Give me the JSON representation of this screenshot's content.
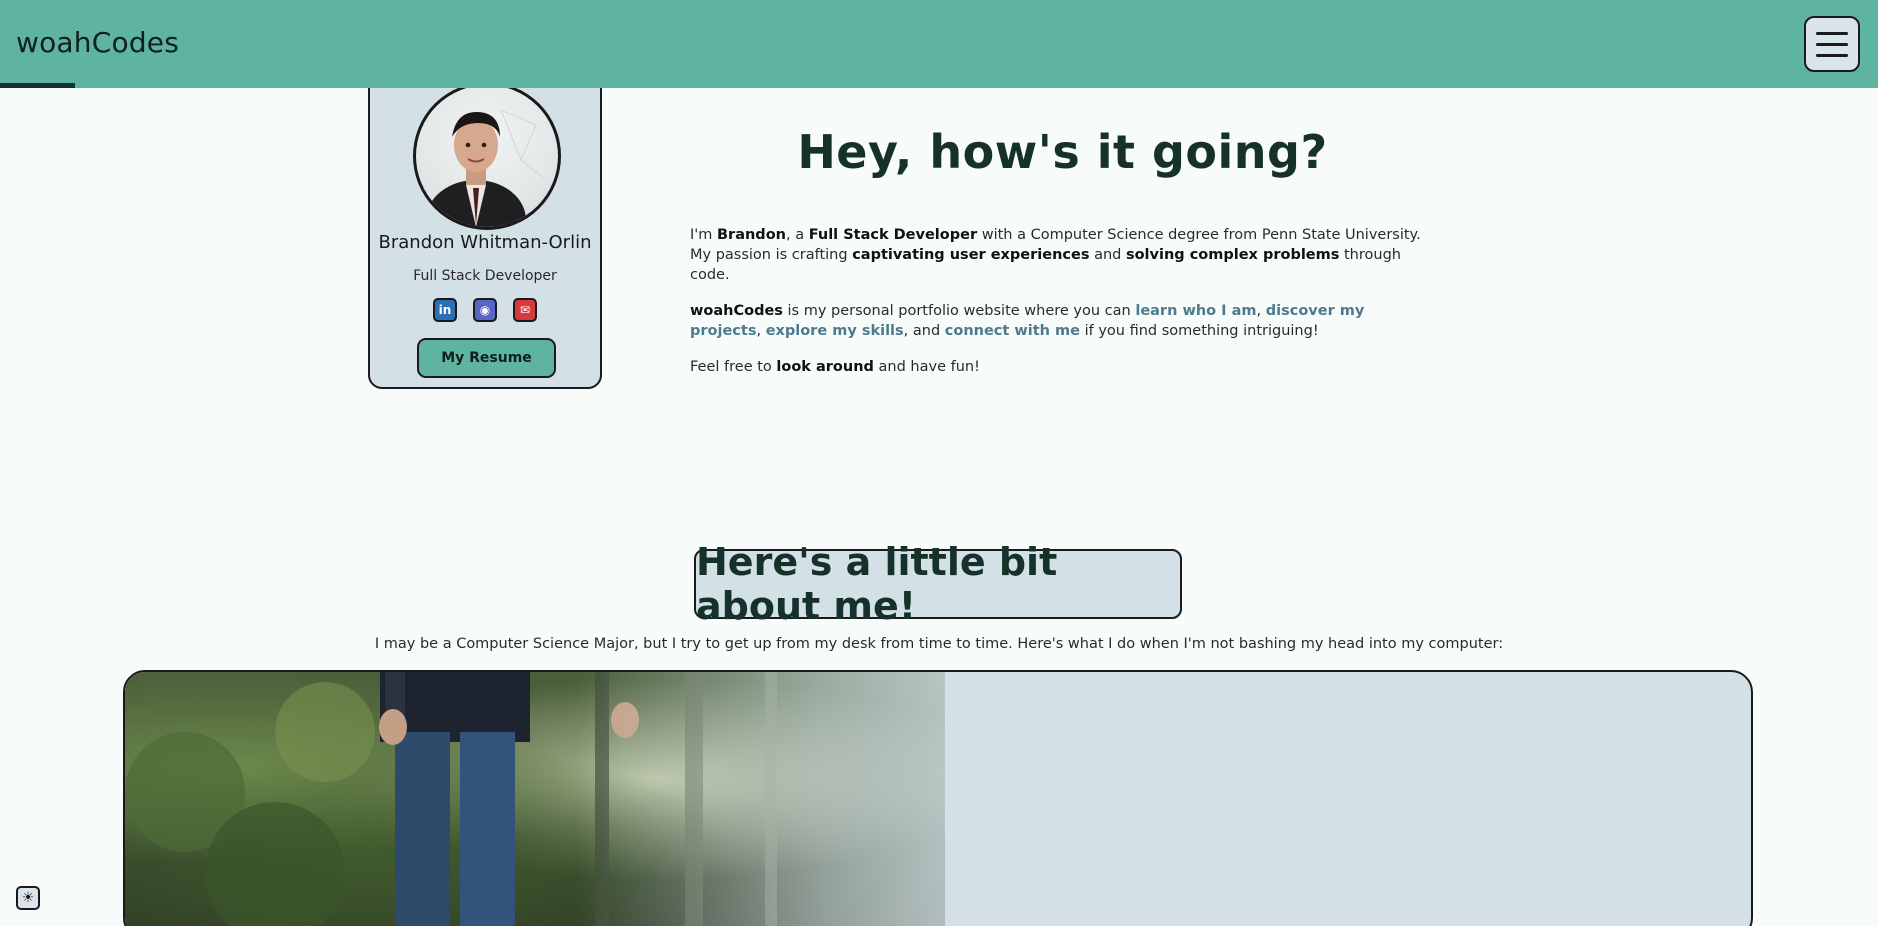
{
  "header": {
    "brand": "woahCodes",
    "menu_icon": "hamburger-menu-icon"
  },
  "profile": {
    "name": "Brandon Whitman-Orlin",
    "role": "Full Stack Developer",
    "avatar_icon": "profile-photo",
    "socials": [
      {
        "name": "linkedin",
        "glyph": "in",
        "color": "#2d6fb3",
        "icon": "linkedin-icon"
      },
      {
        "name": "discord",
        "glyph": "◉",
        "color": "#5865c6",
        "icon": "discord-icon"
      },
      {
        "name": "email",
        "glyph": "✉",
        "color": "#d63b3b",
        "icon": "email-icon"
      }
    ],
    "resume_label": "My Resume"
  },
  "intro": {
    "title": "Hey, how's it going?",
    "p1": {
      "t1": "I'm ",
      "name": "Brandon",
      "t2": ", a ",
      "role": "Full Stack Developer",
      "t3": " with a Computer Science degree from Penn State University. My passion is crafting ",
      "b1": "captivating user experiences",
      "t4": " and ",
      "b2": "solving complex problems",
      "t5": " through code."
    },
    "p2": {
      "site": "woahCodes",
      "t1": " is my personal portfolio website where you can ",
      "l1": "learn who I am",
      "t2": ", ",
      "l2": "discover my projects",
      "t3": ", ",
      "l3": "explore my skills",
      "t4": ", and ",
      "l4": "connect with me",
      "t5": " if you find something intriguing!"
    },
    "p3": {
      "t1": "Feel free to ",
      "b1": "look around",
      "t2": " and have fun!"
    }
  },
  "about": {
    "title": "Here's a little bit about me!",
    "subtitle": "I may be a Computer Science Major, but I try to get up from my desk from time to time. Here's what I do when I'm not bashing my head into my computer:"
  },
  "theme_toggle": {
    "icon": "sun-icon",
    "glyph": "☀"
  },
  "colors": {
    "header_bg": "#5eb3a1",
    "card_bg": "#d3e0e6",
    "link": "#4e7a8f",
    "page_bg": "#f7fcfa"
  }
}
